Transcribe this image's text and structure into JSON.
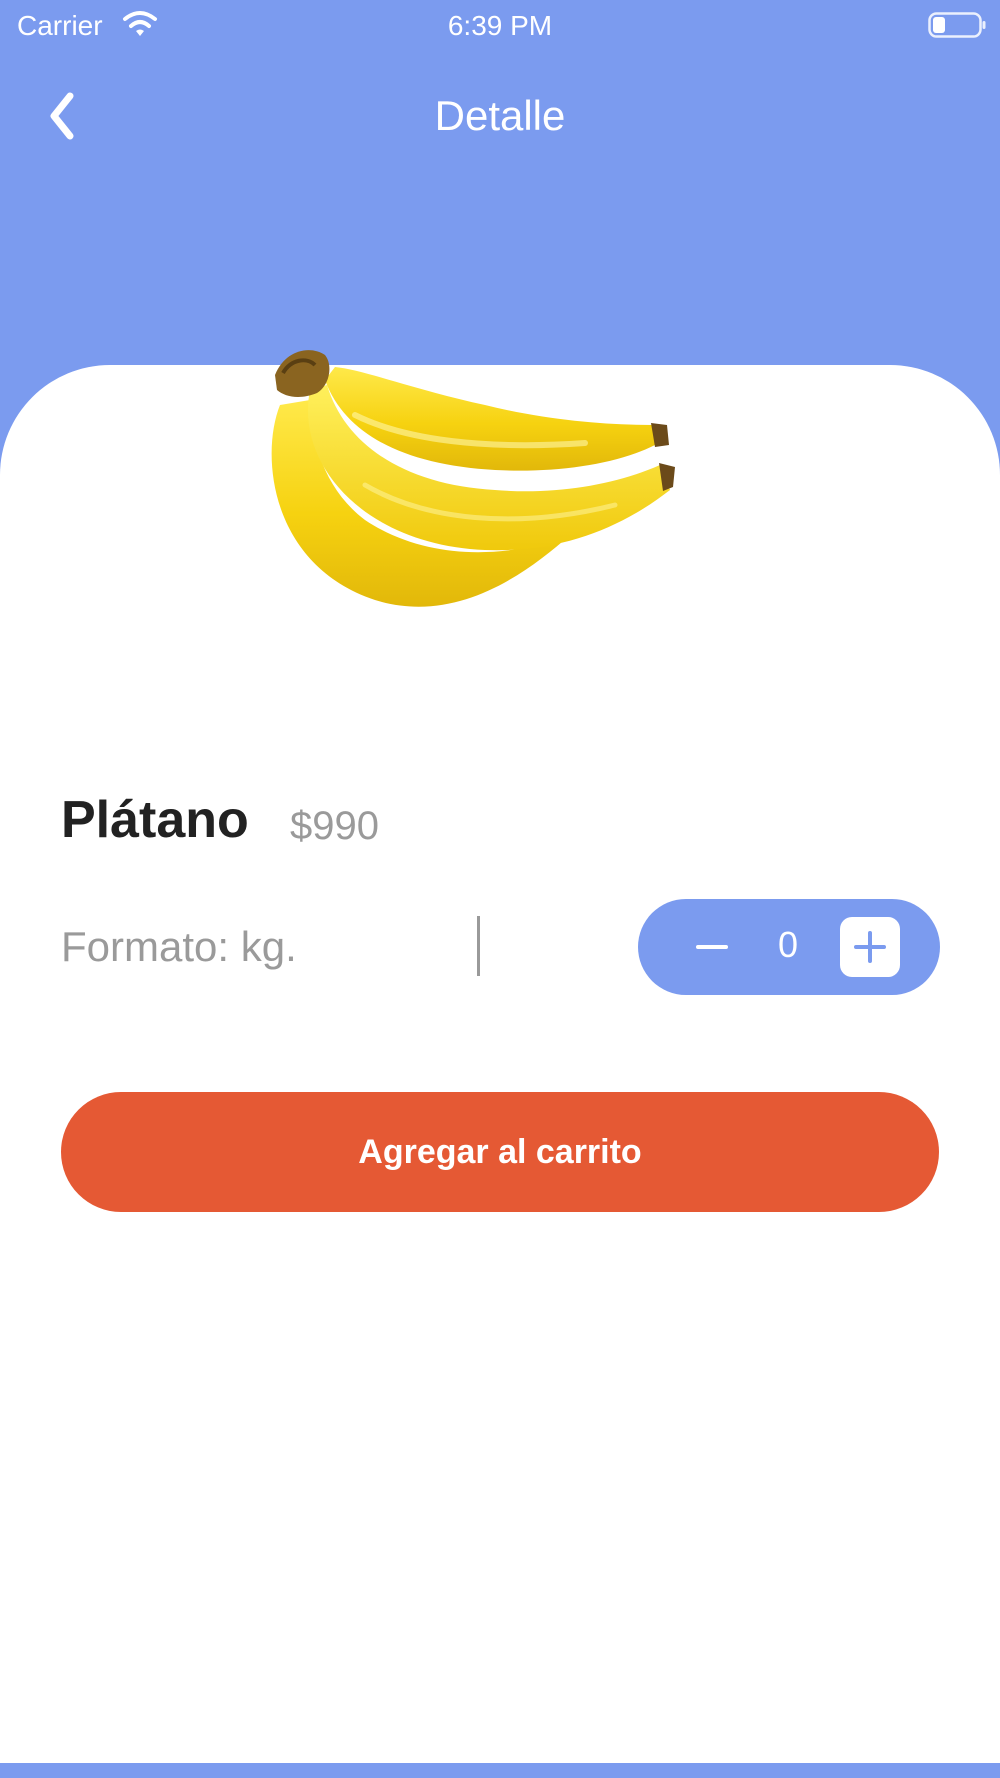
{
  "status_bar": {
    "carrier": "Carrier",
    "time": "6:39 PM",
    "wifi_icon": "wifi-icon",
    "battery_icon": "battery-icon"
  },
  "header": {
    "title": "Detalle",
    "back_icon": "chevron-left-icon"
  },
  "product": {
    "image": "banana-image",
    "name": "Plátano",
    "price": "$990",
    "format": "Formato: kg."
  },
  "stepper": {
    "quantity": "0",
    "decrement_icon": "minus-icon",
    "increment_icon": "plus-icon"
  },
  "actions": {
    "add_to_cart_label": "Agregar al carrito"
  },
  "colors": {
    "header": "#7b9bef",
    "accent_button": "#e55934",
    "price_text": "#9a9a9a",
    "product_name": "#222222"
  }
}
